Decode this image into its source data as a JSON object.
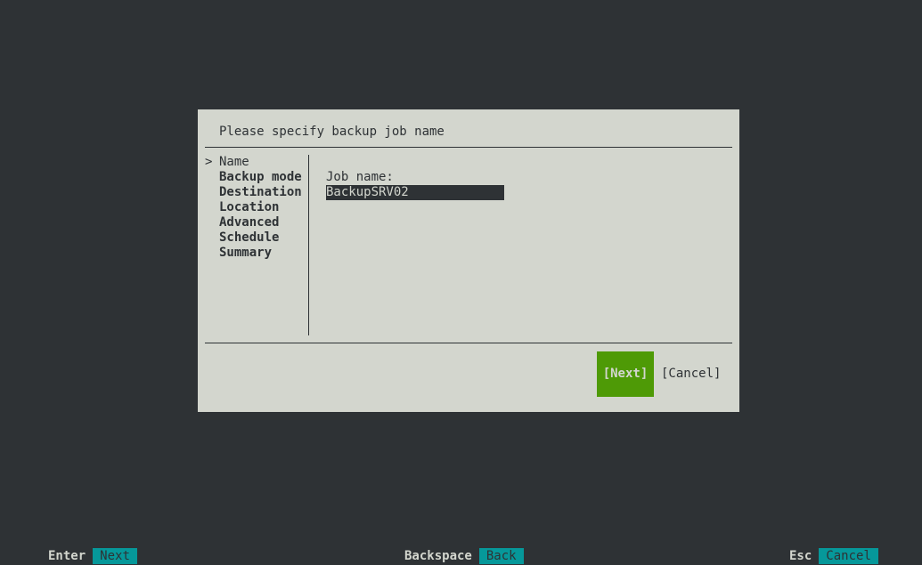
{
  "dialog": {
    "title": "Please specify backup job name",
    "steps": [
      {
        "marker": ">",
        "label": "Name",
        "current": true
      },
      {
        "marker": "",
        "label": "Backup mode",
        "current": false
      },
      {
        "marker": "",
        "label": "Destination",
        "current": false
      },
      {
        "marker": "",
        "label": "Location",
        "current": false
      },
      {
        "marker": "",
        "label": "Advanced",
        "current": false
      },
      {
        "marker": "",
        "label": "Schedule",
        "current": false
      },
      {
        "marker": "",
        "label": "Summary",
        "current": false
      }
    ],
    "field_label": "Job name:",
    "field_value": "BackupSRV02",
    "next_label": "[Next]",
    "cancel_label": "[Cancel]"
  },
  "hints": [
    {
      "key": "Enter",
      "action": "Next"
    },
    {
      "key": "Backspace",
      "action": "Back"
    },
    {
      "key": "Esc",
      "action": "Cancel"
    }
  ],
  "colors": {
    "background": "#2e3235",
    "dialog": "#d3d6ce",
    "accent_button": "#4e9a06",
    "hint_action": "#06989a"
  }
}
